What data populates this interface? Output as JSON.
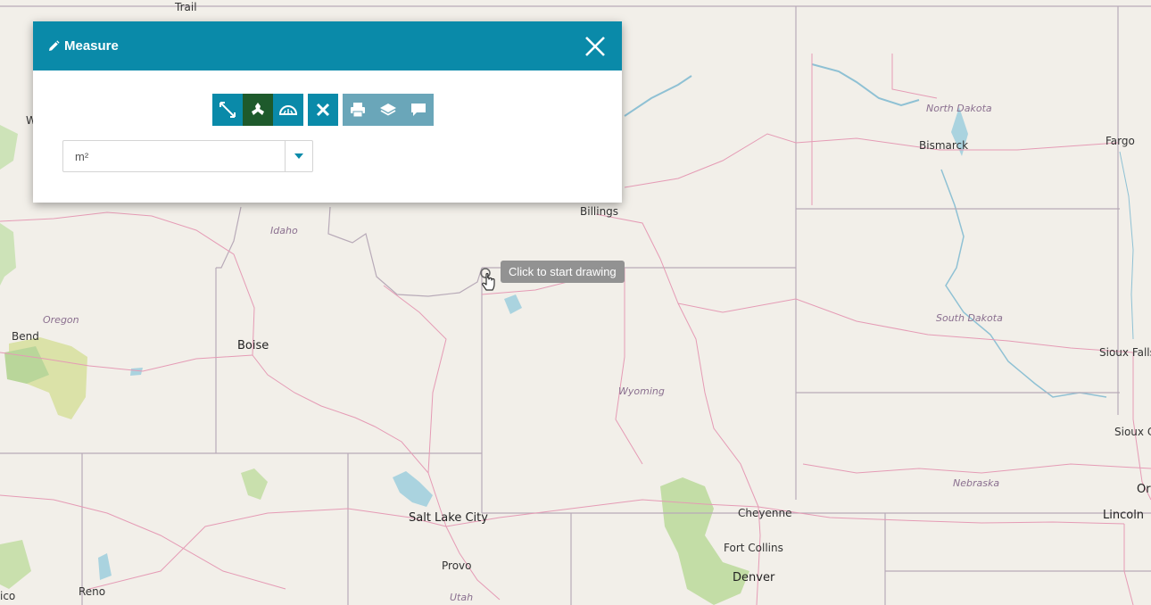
{
  "panel": {
    "title": "Measure",
    "icons": {
      "title": "pencil-icon",
      "close": "close-icon",
      "tools": [
        "line-measure-icon",
        "area-measure-icon",
        "angle-measure-icon",
        "clear-icon",
        "print-icon",
        "layers-icon",
        "comment-icon"
      ]
    },
    "unit": {
      "selected": "m²"
    }
  },
  "tooltip": {
    "text": "Click to start drawing"
  },
  "map": {
    "labels": [
      {
        "text": "Trail",
        "kind": "city"
      },
      {
        "text": "North Dakota",
        "kind": "state"
      },
      {
        "text": "Bismarck",
        "kind": "city"
      },
      {
        "text": "Fargo",
        "kind": "city"
      },
      {
        "text": "Billings",
        "kind": "city"
      },
      {
        "text": "Idaho",
        "kind": "state"
      },
      {
        "text": "Oregon",
        "kind": "state"
      },
      {
        "text": "Bend",
        "kind": "city"
      },
      {
        "text": "Boise",
        "kind": "city"
      },
      {
        "text": "South Dakota",
        "kind": "state"
      },
      {
        "text": "Sioux Falls",
        "kind": "city"
      },
      {
        "text": "Wyoming",
        "kind": "state"
      },
      {
        "text": "Sioux Ci",
        "kind": "city"
      },
      {
        "text": "Nebraska",
        "kind": "state"
      },
      {
        "text": "Or",
        "kind": "city"
      },
      {
        "text": "Salt Lake City",
        "kind": "city"
      },
      {
        "text": "Cheyenne",
        "kind": "city"
      },
      {
        "text": "Lincoln",
        "kind": "city"
      },
      {
        "text": "Fort Collins",
        "kind": "city"
      },
      {
        "text": "Provo",
        "kind": "city"
      },
      {
        "text": "Denver",
        "kind": "city"
      },
      {
        "text": "Reno",
        "kind": "city"
      },
      {
        "text": "Utah",
        "kind": "state"
      },
      {
        "text": "ico",
        "kind": "city"
      },
      {
        "text": "W",
        "kind": "city"
      }
    ]
  },
  "colors": {
    "header": "#0a8aa9",
    "tool_active": "#1e5a2c",
    "tool_muted": "#6aa6b9",
    "tooltip_bg": "#929292"
  }
}
